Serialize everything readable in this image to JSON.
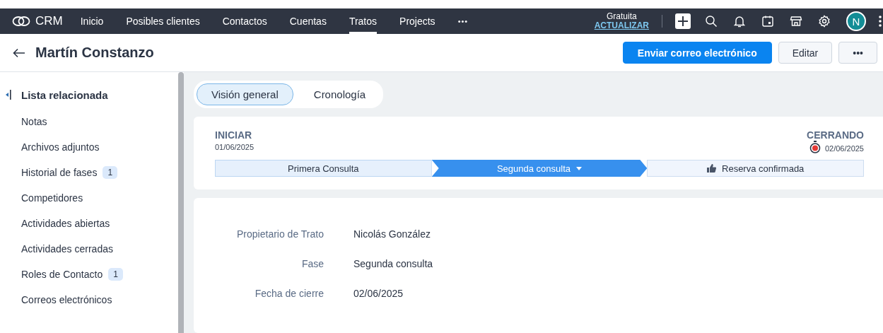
{
  "nav": {
    "brand": "CRM",
    "tabs": [
      {
        "label": "Inicio",
        "selected": false
      },
      {
        "label": "Posibles clientes",
        "selected": false
      },
      {
        "label": "Contactos",
        "selected": false
      },
      {
        "label": "Cuentas",
        "selected": false
      },
      {
        "label": "Tratos",
        "selected": true
      },
      {
        "label": "Projects",
        "selected": false
      }
    ],
    "more": "•••",
    "plan": "Gratuita",
    "upgrade": "ACTUALIZAR",
    "avatar": "N"
  },
  "header": {
    "title": "Martín Constanzo",
    "buttons": [
      {
        "label": "Enviar correo electrónico",
        "kind": "primary"
      },
      {
        "label": "Editar",
        "kind": "secondary"
      },
      {
        "label": "•••",
        "kind": "secondary"
      }
    ]
  },
  "sidebar": {
    "title": "Lista relacionada",
    "items": [
      {
        "label": "Notas"
      },
      {
        "label": "Archivos adjuntos"
      },
      {
        "label": "Historial de fases",
        "count": "1"
      },
      {
        "label": "Competidores"
      },
      {
        "label": "Actividades abiertas"
      },
      {
        "label": "Actividades cerradas"
      },
      {
        "label": "Roles de Contacto",
        "count": "1"
      },
      {
        "label": "Correos electrónicos"
      }
    ]
  },
  "view_tabs": [
    {
      "label": "Visión general",
      "selected": true
    },
    {
      "label": "Cronología",
      "selected": false
    }
  ],
  "stage_card": {
    "start_label": "INICIAR",
    "start_date": "01/06/2025",
    "end_label": "CERRANDO",
    "end_date": "02/06/2025",
    "stages": [
      {
        "label": "Primera Consulta",
        "kind": "done"
      },
      {
        "label": "Segunda consulta",
        "kind": "current"
      },
      {
        "label": "Reserva confirmada",
        "kind": "pending"
      }
    ]
  },
  "details": [
    {
      "label": "Propietario de Trato",
      "value": "Nicolás González"
    },
    {
      "label": "Fase",
      "value": "Segunda consulta"
    },
    {
      "label": "Fecha de cierre",
      "value": "02/06/2025"
    }
  ]
}
